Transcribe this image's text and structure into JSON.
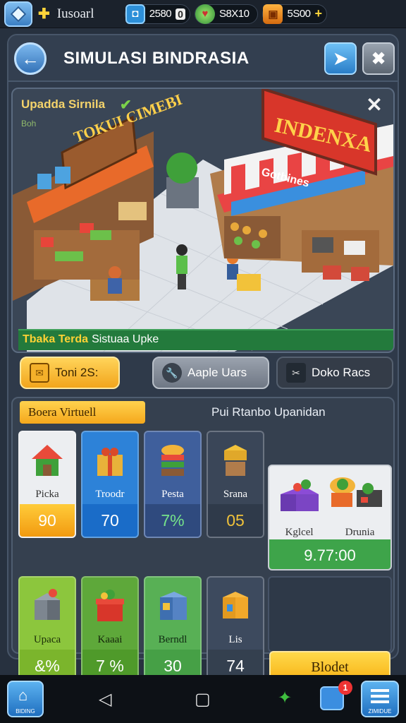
{
  "status_bar": {
    "user_name": "Iusoarl",
    "resources": [
      {
        "name": "coins",
        "value": "2580",
        "extra": "0"
      },
      {
        "name": "gems",
        "value": "S8X10"
      },
      {
        "name": "gifts",
        "value": "5S00"
      }
    ]
  },
  "header": {
    "title": "SIMULASI BINDRASIA"
  },
  "scene": {
    "title": "Upadda Sirnila",
    "subtitle": "Boh",
    "left_shop_sign": "TOKUI CIMEBI",
    "right_shop_sign": "INDENXA",
    "right_awning_sign": "Gotbines",
    "banner_highlight": "Tbaka Terda",
    "banner_text": "Sistuaa Upke"
  },
  "actions": [
    {
      "label": "Toni 2S:"
    },
    {
      "label": "Aaple Uars"
    },
    {
      "label": "Doko Racs"
    }
  ],
  "lower_panel": {
    "active_tab": "Boera Virtuell",
    "other_tab": "Pui Rtanbo Upanidan",
    "cards_row1": [
      {
        "label": "Picka",
        "value": "90"
      },
      {
        "label": "Troodr",
        "value": "70"
      },
      {
        "label": "Pesta",
        "value": "7%"
      },
      {
        "label": "Srana",
        "value": "05"
      }
    ],
    "big_card": {
      "labels": [
        "Kglcel",
        "Drunia"
      ],
      "value": "9.77:00"
    },
    "cards_row2": [
      {
        "label": "Upaca",
        "value": "&%"
      },
      {
        "label": "Kaaai",
        "value": "7 %"
      },
      {
        "label": "Berndl",
        "value": "30"
      },
      {
        "label": "Lis",
        "value": "74"
      }
    ],
    "buy_button": "Blodet"
  },
  "navbar": {
    "home_label": "BIDING",
    "menu_label": "ZIMIDUE",
    "badge_count": "1"
  }
}
